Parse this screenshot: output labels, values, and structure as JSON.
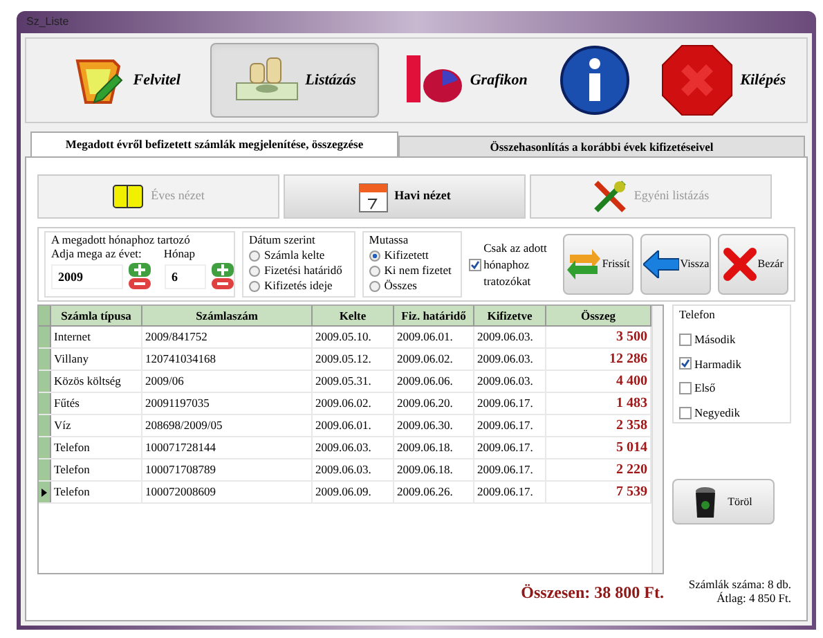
{
  "window": {
    "title": "Sz_Liste"
  },
  "toolbar": [
    {
      "kind": "entry",
      "label": "Felvitel",
      "selected": false
    },
    {
      "kind": "list",
      "label": "Listázás",
      "selected": true
    },
    {
      "kind": "chart",
      "label": "Grafikon",
      "selected": false
    },
    {
      "kind": "info",
      "selected": false
    },
    {
      "kind": "exit",
      "label": "Kilépés",
      "selected": false
    }
  ],
  "tabs": [
    {
      "label": "Megadott évről befizetett számlák megjelenítése, összegzése",
      "selected": true
    },
    {
      "label": "Összehasonlítás a korábbi évek kifizetéseivel",
      "selected": false
    }
  ],
  "view_buttons": [
    {
      "kind": "book",
      "label": "Éves nézet",
      "selected": false
    },
    {
      "kind": "calendar",
      "label": "Havi nézet",
      "selected": true
    },
    {
      "kind": "tools",
      "label": "Egyéni listázás",
      "selected": false
    }
  ],
  "period": {
    "title": "A megadott hónaphoz tartozó",
    "year_label": "Adja mega az évet:",
    "year": "2009",
    "month_label": "Hónap",
    "month": "6"
  },
  "date_by": {
    "title": "Dátum szerint",
    "options": [
      {
        "label": "Számla kelte",
        "selected": false
      },
      {
        "label": "Fizetési határidő",
        "selected": false
      },
      {
        "label": "Kifizetés ideje",
        "selected": false
      }
    ]
  },
  "show": {
    "title": "Mutassa",
    "options": [
      {
        "label": "Kifizetett",
        "selected": true
      },
      {
        "label": "Ki nem fizetet",
        "selected": false
      },
      {
        "label": "Összes",
        "selected": false
      }
    ]
  },
  "only_month": {
    "label": "Csak az adott hónaphoz tratozókat",
    "checked": true
  },
  "actions": [
    {
      "kind": "refresh",
      "label": "Frissít"
    },
    {
      "kind": "back",
      "label": "Vissza"
    },
    {
      "kind": "close",
      "label": "Bezár"
    }
  ],
  "table": {
    "columns": [
      "Számla típusa",
      "Számlaszám",
      "Kelte",
      "Fiz. határidő",
      "Kifizetve",
      "Összeg"
    ],
    "rows": [
      {
        "current": false,
        "cells": [
          "Internet",
          "2009/841752",
          "2009.05.10.",
          "2009.06.01.",
          "2009.06.03.",
          "3 500"
        ]
      },
      {
        "current": false,
        "cells": [
          "Villany",
          "120741034168",
          "2009.05.12.",
          "2009.06.02.",
          "2009.06.03.",
          "12 286"
        ]
      },
      {
        "current": false,
        "cells": [
          "Közös költség",
          "2009/06",
          "2009.05.31.",
          "2009.06.06.",
          "2009.06.03.",
          "4 400"
        ]
      },
      {
        "current": false,
        "cells": [
          "Fűtés",
          "20091197035",
          "2009.06.02.",
          "2009.06.20.",
          "2009.06.17.",
          "1 483"
        ]
      },
      {
        "current": false,
        "cells": [
          "Víz",
          "208698/2009/05",
          "2009.06.01.",
          "2009.06.30.",
          "2009.06.17.",
          "2 358"
        ]
      },
      {
        "current": false,
        "cells": [
          "Telefon",
          "100071728144",
          "2009.06.03.",
          "2009.06.18.",
          "2009.06.17.",
          "5 014"
        ]
      },
      {
        "current": false,
        "cells": [
          "Telefon",
          "100071708789",
          "2009.06.03.",
          "2009.06.18.",
          "2009.06.17.",
          "2 220"
        ]
      },
      {
        "current": true,
        "cells": [
          "Telefon",
          "100072008609",
          "2009.06.09.",
          "2009.06.26.",
          "2009.06.17.",
          "7 539"
        ]
      }
    ]
  },
  "filter_group": {
    "title": "Telefon",
    "options": [
      {
        "label": "Második",
        "checked": false
      },
      {
        "label": "Harmadik",
        "checked": true
      },
      {
        "label": "Első",
        "checked": false
      },
      {
        "label": "Negyedik",
        "checked": false
      }
    ]
  },
  "delete_button": {
    "label": "Töröl"
  },
  "total": "Összesen: 38 800 Ft.",
  "stats": [
    "Számlák száma: 8 db.",
    "Átlag: 4 850 Ft."
  ]
}
